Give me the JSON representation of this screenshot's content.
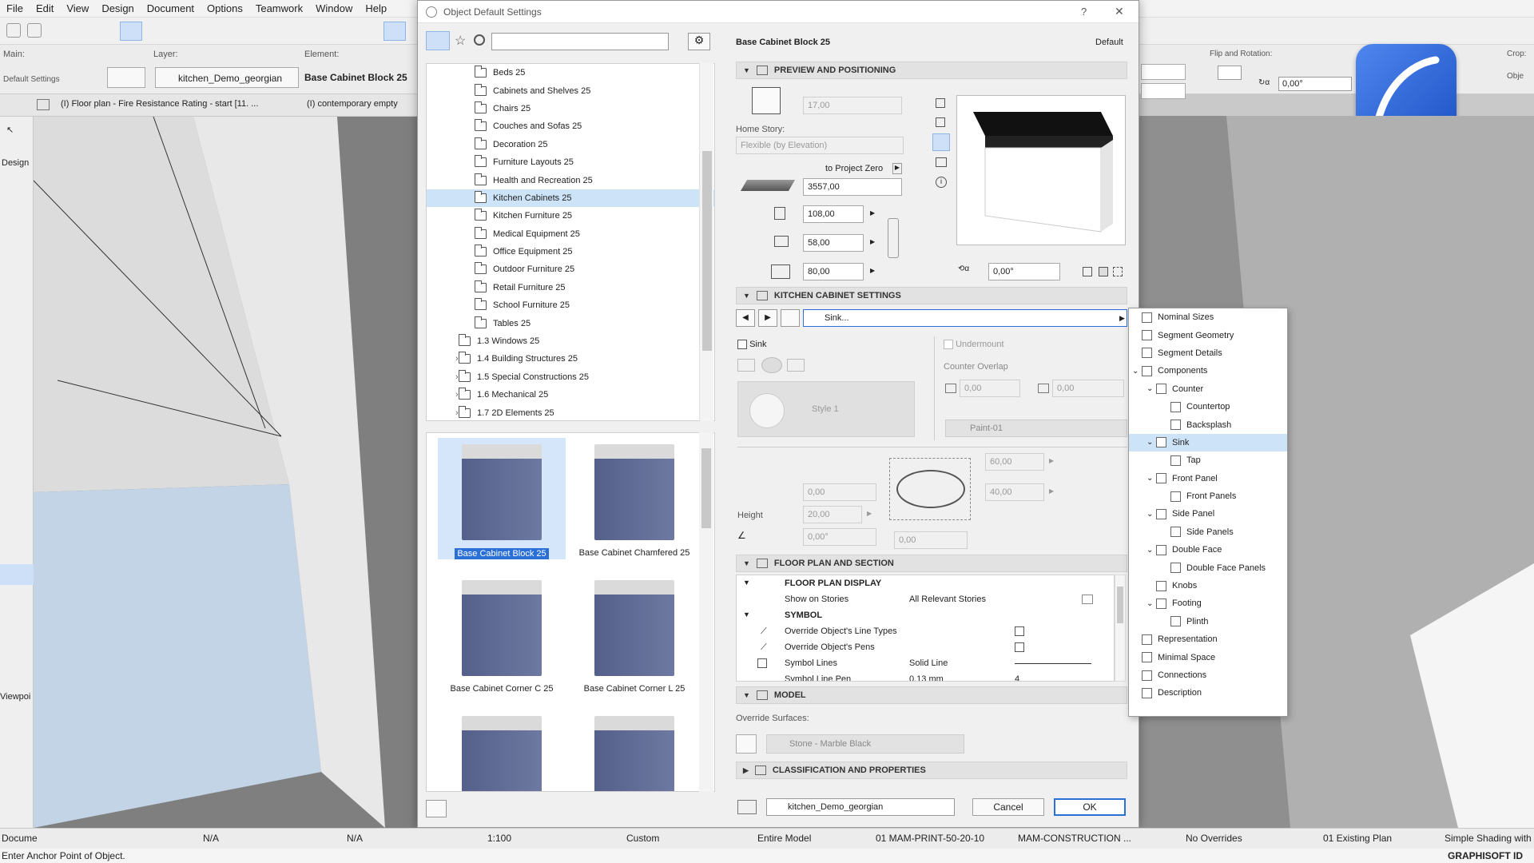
{
  "menu": [
    "File",
    "Edit",
    "View",
    "Design",
    "Document",
    "Options",
    "Teamwork",
    "Window",
    "Help"
  ],
  "infobar": {
    "main_label": "Main:",
    "layer_label": "Layer:",
    "element_label": "Element:",
    "default_settings": "Default Settings",
    "layer_value": "kitchen_Demo_georgian",
    "element_value": "Base Cabinet Block 25",
    "flip_label": "Flip and Rotation:",
    "rotation_value": "0,00°",
    "crop_label": "Crop:",
    "obj_label": "Obje"
  },
  "tabs": [
    "(I) Floor plan - Fire Resistance Rating - start [11. ...",
    "(I) contemporary empty"
  ],
  "left_labels": {
    "design": "Design",
    "viewpoint": "Viewpoi"
  },
  "dialog": {
    "title": "Object Default Settings",
    "help": "?",
    "close": "✕",
    "object_name": "Base Cabinet Block 25",
    "default_label": "Default",
    "search_placeholder": "",
    "tree": [
      {
        "label": "Beds 25",
        "indent": 2
      },
      {
        "label": "Cabinets and Shelves 25",
        "indent": 2
      },
      {
        "label": "Chairs 25",
        "indent": 2
      },
      {
        "label": "Couches and Sofas 25",
        "indent": 2
      },
      {
        "label": "Decoration 25",
        "indent": 2
      },
      {
        "label": "Furniture Layouts 25",
        "indent": 2
      },
      {
        "label": "Health and Recreation 25",
        "indent": 2
      },
      {
        "label": "Kitchen Cabinets 25",
        "indent": 2,
        "selected": true
      },
      {
        "label": "Kitchen Furniture 25",
        "indent": 2
      },
      {
        "label": "Medical Equipment 25",
        "indent": 2
      },
      {
        "label": "Office Equipment 25",
        "indent": 2
      },
      {
        "label": "Outdoor Furniture 25",
        "indent": 2
      },
      {
        "label": "Retail Furniture 25",
        "indent": 2
      },
      {
        "label": "School Furniture 25",
        "indent": 2
      },
      {
        "label": "Tables 25",
        "indent": 2
      },
      {
        "label": "1.3 Windows 25",
        "indent": 1
      },
      {
        "label": "1.4 Building Structures 25",
        "indent": 1,
        "expander": "›"
      },
      {
        "label": "1.5 Special Constructions 25",
        "indent": 1,
        "expander": "›"
      },
      {
        "label": "1.6 Mechanical 25",
        "indent": 1,
        "expander": "›"
      },
      {
        "label": "1.7 2D Elements 25",
        "indent": 1,
        "expander": "›"
      }
    ],
    "thumbs": [
      {
        "label": "Base Cabinet Block 25",
        "selected": true
      },
      {
        "label": "Base Cabinet Chamfered 25"
      },
      {
        "label": "Base Cabinet Corner C 25"
      },
      {
        "label": "Base Cabinet Corner L 25"
      },
      {
        "label": ""
      },
      {
        "label": ""
      }
    ],
    "preview": {
      "header": "PREVIEW AND POSITIONING",
      "elev_value": "17,00",
      "home_story_label": "Home Story:",
      "home_story_value": "Flexible (by Elevation)",
      "to_project_zero": "to Project Zero",
      "zero_value": "3557,00",
      "dim1": "108,00",
      "dim2": "58,00",
      "dim3": "80,00",
      "angle": "0,00°"
    },
    "kcs": {
      "header": "KITCHEN CABINET SETTINGS",
      "page_select": "Sink...",
      "sink_label": "Sink",
      "undermount_label": "Undermount",
      "counter_overlap": "Counter Overlap",
      "overlap1": "0,00",
      "overlap2": "0,00",
      "style": "Style 1",
      "paint": "Paint-01",
      "v60": "60,00",
      "v40": "40,00",
      "v0a": "0,00",
      "height_label": "Height",
      "height_value": "20,00",
      "angle_value": "0,00°",
      "v0b": "0,00"
    },
    "fps": {
      "header": "FLOOR PLAN AND SECTION",
      "sub1": "FLOOR PLAN DISPLAY",
      "show_on_stories": "Show on Stories",
      "all_relevant": "All Relevant Stories",
      "sub2": "SYMBOL",
      "override_line": "Override Object's Line Types",
      "override_pens": "Override Object's Pens",
      "symbol_lines": "Symbol Lines",
      "solid_line": "Solid Line",
      "symbol_pen": "Symbol Line Pen",
      "pen_value": "0,13 mm",
      "pen_num": "4"
    },
    "model": {
      "header": "MODEL",
      "override_surfaces": "Override Surfaces:",
      "surface": "Stone - Marble Black"
    },
    "classification": {
      "header": "CLASSIFICATION AND PROPERTIES"
    },
    "footer": {
      "layer": "kitchen_Demo_georgian",
      "cancel": "Cancel",
      "ok": "OK"
    }
  },
  "popup": [
    {
      "label": "Nominal Sizes",
      "indent": 0
    },
    {
      "label": "Segment Geometry",
      "indent": 0
    },
    {
      "label": "Segment Details",
      "indent": 0
    },
    {
      "label": "Components",
      "indent": 0,
      "exp": "⌄"
    },
    {
      "label": "Counter",
      "indent": 1,
      "exp": "⌄"
    },
    {
      "label": "Countertop",
      "indent": 2
    },
    {
      "label": "Backsplash",
      "indent": 2
    },
    {
      "label": "Sink",
      "indent": 1,
      "exp": "⌄",
      "selected": true
    },
    {
      "label": "Tap",
      "indent": 2
    },
    {
      "label": "Front Panel",
      "indent": 1,
      "exp": "⌄"
    },
    {
      "label": "Front Panels",
      "indent": 2
    },
    {
      "label": "Side Panel",
      "indent": 1,
      "exp": "⌄"
    },
    {
      "label": "Side Panels",
      "indent": 2
    },
    {
      "label": "Double Face",
      "indent": 1,
      "exp": "⌄"
    },
    {
      "label": "Double Face Panels",
      "indent": 2
    },
    {
      "label": "Knobs",
      "indent": 1
    },
    {
      "label": "Footing",
      "indent": 1,
      "exp": "⌄"
    },
    {
      "label": "Plinth",
      "indent": 2
    },
    {
      "label": "Representation",
      "indent": 0
    },
    {
      "label": "Minimal Space",
      "indent": 0
    },
    {
      "label": "Connections",
      "indent": 0
    },
    {
      "label": "Description",
      "indent": 0
    }
  ],
  "statusbar": {
    "docume": "Docume",
    "na1": "N/A",
    "na2": "N/A",
    "scale": "1:100",
    "custom": "Custom",
    "model": "Entire Model",
    "print": "01 MAM-PRINT-50-20-10",
    "construction": "MAM-CONSTRUCTION ...",
    "overrides": "No Overrides",
    "existing": "01 Existing Plan",
    "shading": "Simple Shading with"
  },
  "bottom": {
    "hint": "Enter Anchor Point of Object.",
    "brand": "GRAPHISOFT ID"
  },
  "colors": {
    "accent": "#2a6fd6",
    "selection": "#cde3f8",
    "cabinet": "#5e6892",
    "logo": "#2d6be0"
  }
}
